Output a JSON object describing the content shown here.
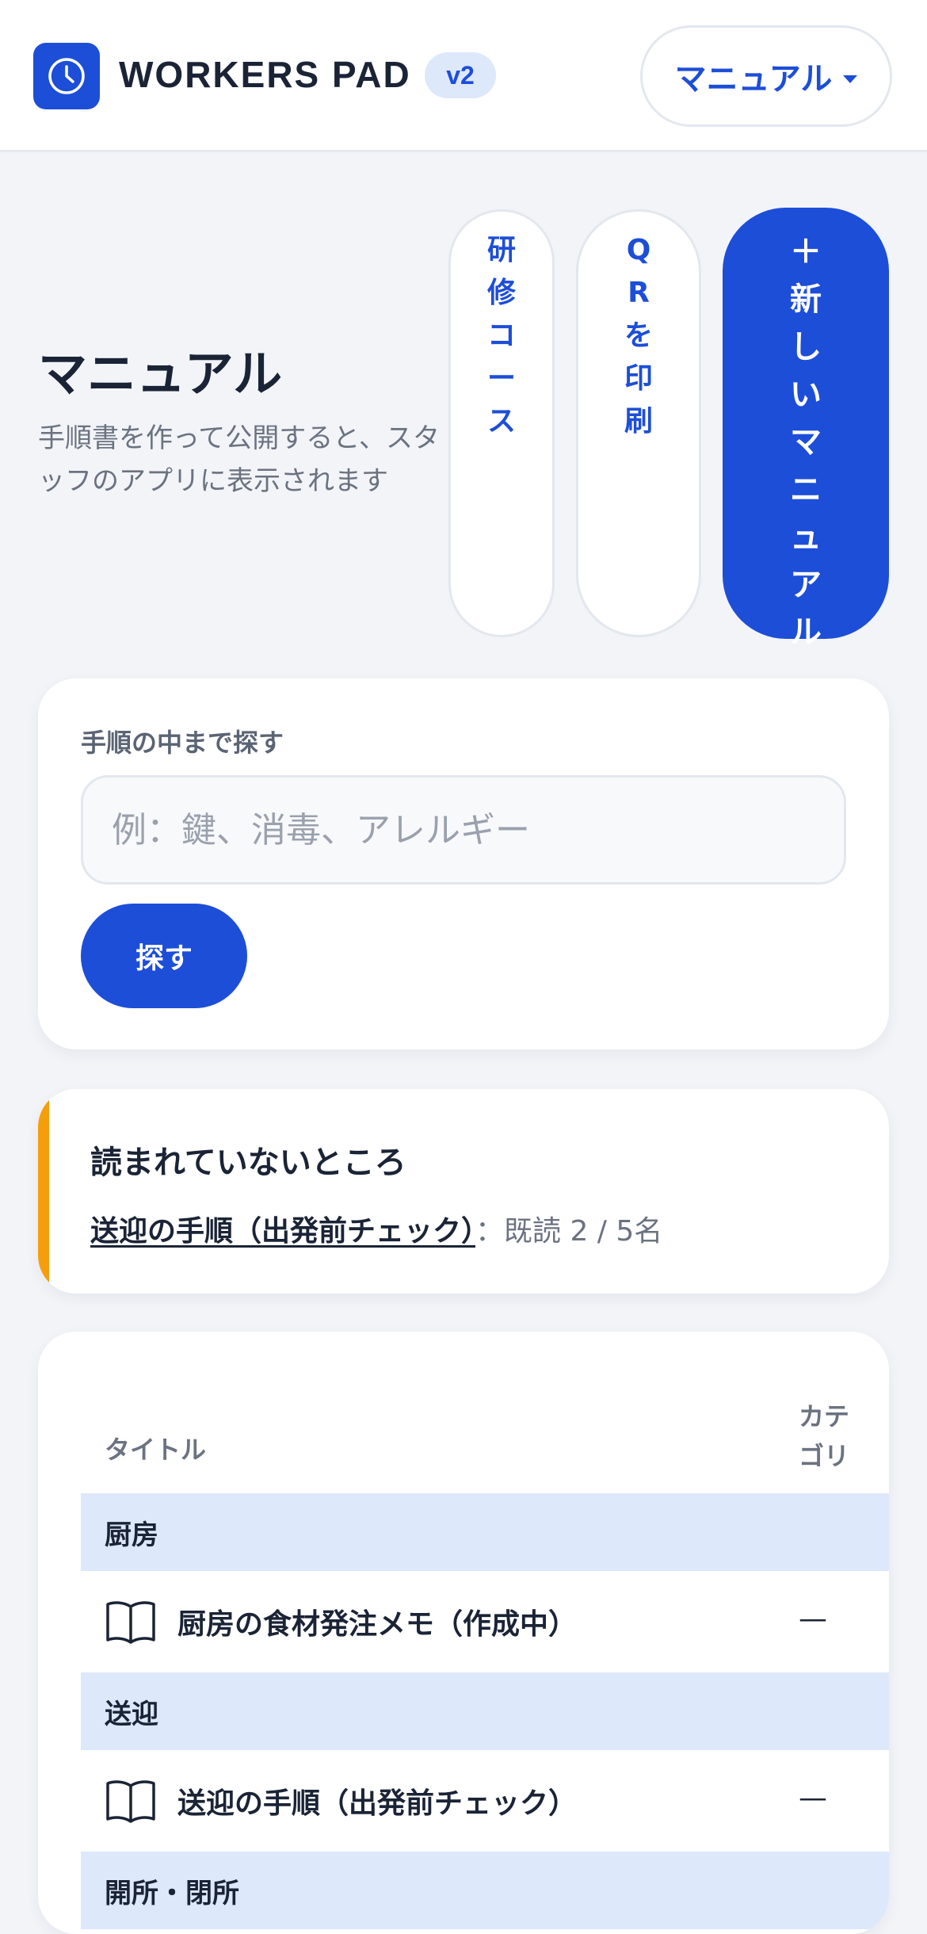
{
  "app": {
    "brand": "WORKERS PAD",
    "version": "v2",
    "logo_icon": "clock-icon",
    "accent": "#1d4ed8"
  },
  "header": {
    "menu_label": "マニュアル",
    "menu_icon": "caret-down-icon"
  },
  "page": {
    "title": "マニュアル",
    "subtitle": "手順書を作って公開すると、スタッフのアプリに表示されます"
  },
  "actions": {
    "training": "研修コース",
    "qr_print": "QRを印刷",
    "new_manual": "＋新しいマニュアル"
  },
  "search": {
    "label": "手順の中まで探す",
    "placeholder": "例：鍵、消毒、アレルギー",
    "value": "",
    "button": "探す"
  },
  "unread": {
    "title": "読まれていないところ",
    "link": "送迎の手順（出発前チェック）",
    "stat": "：既読 2 / 5名",
    "accent": "#f59e0b"
  },
  "table": {
    "col_title": "タイトル",
    "col_category": "カテゴリ",
    "groups": [
      {
        "name": "厨房",
        "items": [
          {
            "title": "厨房の食材発注メモ（作成中）",
            "category": "—",
            "icon": "book-icon"
          }
        ]
      },
      {
        "name": "送迎",
        "items": [
          {
            "title": "送迎の手順（出発前チェック）",
            "category": "—",
            "icon": "book-icon"
          }
        ]
      },
      {
        "name": "開所・閉所",
        "items": []
      }
    ]
  }
}
